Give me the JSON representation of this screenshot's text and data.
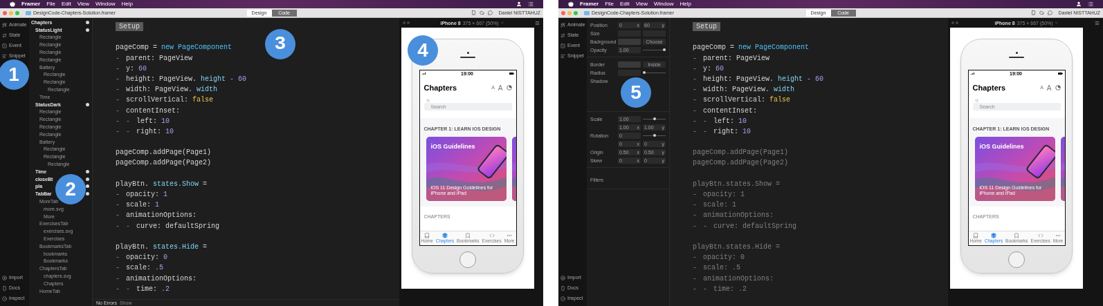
{
  "windows": [
    {
      "menu_bar": {
        "app": "Framer",
        "items": [
          "File",
          "Edit",
          "View",
          "Window",
          "Help"
        ]
      },
      "title_bar": {
        "title": "DesignCode-Chapters-Solution.framer",
        "modes": [
          {
            "label": "Design",
            "selected": false
          },
          {
            "label": "Code",
            "selected": true
          }
        ],
        "user": "Daniel NISTTAHUZ"
      },
      "tool_sidebar": {
        "badge": "1",
        "top": [
          {
            "kind": "animate",
            "label": "Animate"
          },
          {
            "kind": "state",
            "label": "State"
          },
          {
            "kind": "event",
            "label": "Event"
          },
          {
            "kind": "snippet",
            "label": "Snippet"
          }
        ],
        "bottom": [
          {
            "kind": "import",
            "label": "Import"
          },
          {
            "kind": "docs",
            "label": "Docs"
          },
          {
            "kind": "inspect",
            "label": "Inspect"
          }
        ]
      },
      "panel": {
        "kind": "layers",
        "badge": "2",
        "layers": [
          {
            "name": "Chapters",
            "children": [
              {
                "name": "StatusLight",
                "children": [
                  {
                    "name": "Rectangle"
                  },
                  {
                    "name": "Rectangle"
                  },
                  {
                    "name": "Rectangle"
                  },
                  {
                    "name": "Rectangle"
                  },
                  {
                    "name": "Battery",
                    "children": [
                      {
                        "name": "Rectangle"
                      },
                      {
                        "name": "Rectangle",
                        "children": [
                          {
                            "name": "Rectangle"
                          }
                        ]
                      }
                    ]
                  },
                  {
                    "name": "Time"
                  }
                ]
              },
              {
                "name": "StatusDark",
                "children": [
                  {
                    "name": "Rectangle"
                  },
                  {
                    "name": "Rectangle"
                  },
                  {
                    "name": "Rectangle"
                  },
                  {
                    "name": "Rectangle"
                  },
                  {
                    "name": "Battery",
                    "children": [
                      {
                        "name": "Rectangle"
                      },
                      {
                        "name": "Rectangle",
                        "children": [
                          {
                            "name": "Rectangle"
                          }
                        ]
                      }
                    ]
                  }
                ]
              },
              {
                "name": "Time"
              },
              {
                "name": "closeBt"
              },
              {
                "name": "pla"
              },
              {
                "name": "TabBar",
                "children": [
                  {
                    "name": "MoreTab",
                    "children": [
                      {
                        "name": "more.svg"
                      },
                      {
                        "name": "More"
                      }
                    ]
                  },
                  {
                    "name": "ExercisesTab",
                    "children": [
                      {
                        "name": "exercises.svg"
                      },
                      {
                        "name": "Exercises"
                      }
                    ]
                  },
                  {
                    "name": "BookmarksTab",
                    "children": [
                      {
                        "name": "bookmarks"
                      },
                      {
                        "name": "Bookmarks"
                      }
                    ]
                  },
                  {
                    "name": "ChaptersTab",
                    "children": [
                      {
                        "name": "chapters.svg"
                      },
                      {
                        "name": "Chapters"
                      }
                    ]
                  },
                  {
                    "name": "HomeTab"
                  }
                ]
              }
            ]
          }
        ]
      },
      "editor": {
        "badge": "3",
        "heading": "Setup",
        "status": {
          "text": "No Errors",
          "action": "Show"
        },
        "lines": [
          {
            "kind": "blank"
          },
          {
            "kind": "code",
            "dimmed": false,
            "tokens": [
              {
                "kind": "text",
                "text": "pageComp ="
              },
              {
                "kind": "keyword",
                "text": "new"
              },
              {
                "kind": "type",
                "text": "PageComponent"
              }
            ]
          },
          {
            "kind": "code",
            "dimmed": false,
            "tokens": [
              {
                "kind": "guide",
                "text": "-"
              },
              {
                "kind": "text",
                "text": "parent: PageView"
              }
            ]
          },
          {
            "kind": "code",
            "dimmed": false,
            "tokens": [
              {
                "kind": "guide",
                "text": "-"
              },
              {
                "kind": "text",
                "text": "y:"
              },
              {
                "kind": "num",
                "text": "60"
              }
            ]
          },
          {
            "kind": "code",
            "dimmed": false,
            "tokens": [
              {
                "kind": "guide",
                "text": "-"
              },
              {
                "kind": "text",
                "text": "height: PageView."
              },
              {
                "kind": "prop",
                "text": "height"
              },
              {
                "kind": "num",
                "text": "- 60"
              }
            ]
          },
          {
            "kind": "code",
            "dimmed": false,
            "tokens": [
              {
                "kind": "guide",
                "text": "-"
              },
              {
                "kind": "text",
                "text": "width: PageView."
              },
              {
                "kind": "prop",
                "text": "width"
              }
            ]
          },
          {
            "kind": "code",
            "dimmed": false,
            "tokens": [
              {
                "kind": "guide",
                "text": "-"
              },
              {
                "kind": "text",
                "text": "scrollVertical:"
              },
              {
                "kind": "bool",
                "text": "false"
              }
            ]
          },
          {
            "kind": "code",
            "dimmed": false,
            "tokens": [
              {
                "kind": "guide",
                "text": "-"
              },
              {
                "kind": "text",
                "text": "contentInset:"
              }
            ]
          },
          {
            "kind": "code",
            "dimmed": false,
            "tokens": [
              {
                "kind": "guide",
                "text": "-"
              },
              {
                "kind": "guide",
                "text": "-"
              },
              {
                "kind": "text",
                "text": "left:"
              },
              {
                "kind": "num",
                "text": "10"
              }
            ]
          },
          {
            "kind": "code",
            "dimmed": false,
            "tokens": [
              {
                "kind": "guide",
                "text": "-"
              },
              {
                "kind": "guide",
                "text": "-"
              },
              {
                "kind": "text",
                "text": "right:"
              },
              {
                "kind": "num",
                "text": "10"
              }
            ]
          },
          {
            "kind": "blank"
          },
          {
            "kind": "code",
            "dimmed": false,
            "tokens": [
              {
                "kind": "text",
                "text": "pageComp.addPage(Page1)"
              }
            ]
          },
          {
            "kind": "code",
            "dimmed": false,
            "tokens": [
              {
                "kind": "text",
                "text": "pageComp.addPage(Page2)"
              }
            ]
          },
          {
            "kind": "blank"
          },
          {
            "kind": "code",
            "dimmed": false,
            "tokens": [
              {
                "kind": "text",
                "text": "playBtn."
              },
              {
                "kind": "prop",
                "text": "states.Show"
              },
              {
                "kind": "text",
                "text": "="
              }
            ]
          },
          {
            "kind": "code",
            "dimmed": false,
            "tokens": [
              {
                "kind": "guide",
                "text": "-"
              },
              {
                "kind": "text",
                "text": "opacity:"
              },
              {
                "kind": "num",
                "text": "1"
              }
            ]
          },
          {
            "kind": "code",
            "dimmed": false,
            "tokens": [
              {
                "kind": "guide",
                "text": "-"
              },
              {
                "kind": "text",
                "text": "scale:"
              },
              {
                "kind": "num",
                "text": "1"
              }
            ]
          },
          {
            "kind": "code",
            "dimmed": false,
            "tokens": [
              {
                "kind": "guide",
                "text": "-"
              },
              {
                "kind": "text",
                "text": "animationOptions:"
              }
            ]
          },
          {
            "kind": "code",
            "dimmed": false,
            "tokens": [
              {
                "kind": "guide",
                "text": "-"
              },
              {
                "kind": "guide",
                "text": "-"
              },
              {
                "kind": "text",
                "text": "curve: defaultSpring"
              }
            ]
          },
          {
            "kind": "blank"
          },
          {
            "kind": "code",
            "dimmed": false,
            "tokens": [
              {
                "kind": "text",
                "text": "playBtn."
              },
              {
                "kind": "prop",
                "text": "states.Hide"
              },
              {
                "kind": "text",
                "text": "="
              }
            ]
          },
          {
            "kind": "code",
            "dimmed": false,
            "tokens": [
              {
                "kind": "guide",
                "text": "-"
              },
              {
                "kind": "text",
                "text": "opacity:"
              },
              {
                "kind": "num",
                "text": "0"
              }
            ]
          },
          {
            "kind": "code",
            "dimmed": false,
            "tokens": [
              {
                "kind": "guide",
                "text": "-"
              },
              {
                "kind": "text",
                "text": "scale:"
              },
              {
                "kind": "num",
                "text": ".5"
              }
            ]
          },
          {
            "kind": "code",
            "dimmed": false,
            "tokens": [
              {
                "kind": "guide",
                "text": "-"
              },
              {
                "kind": "text",
                "text": "animationOptions:"
              }
            ]
          },
          {
            "kind": "code",
            "dimmed": false,
            "tokens": [
              {
                "kind": "guide",
                "text": "-"
              },
              {
                "kind": "guide",
                "text": "-"
              },
              {
                "kind": "text",
                "text": "time:"
              },
              {
                "kind": "num",
                "text": ".2"
              }
            ]
          }
        ]
      },
      "preview": {
        "badge": "4",
        "device": "iPhone 8",
        "size": "375 × 667 (50%)",
        "screen": {
          "time": "19:00",
          "title": "Chapters",
          "text_sizes": [
            "A",
            "A"
          ],
          "search": {
            "placeholder": "Search"
          },
          "section": "CHAPTER 1: LEARN IOS DESIGN",
          "cards": [
            {
              "kind": "course",
              "title": "iOS Guidelines",
              "subtitle": "iOS 11 Design Guidelines for iPhone and iPad"
            },
            {
              "kind": "picture"
            }
          ],
          "list_heading": "CHAPTERS",
          "tabs": [
            {
              "kind": "home",
              "label": "Home",
              "selected": false
            },
            {
              "kind": "chapters",
              "label": "Chapters",
              "selected": true
            },
            {
              "kind": "bookmarks",
              "label": "Bookmarks",
              "selected": false
            },
            {
              "kind": "exercises",
              "label": "Exercises",
              "selected": false
            },
            {
              "kind": "more",
              "label": "More",
              "selected": false
            }
          ]
        }
      }
    },
    {
      "menu_bar": {
        "app": "Framer",
        "items": [
          "File",
          "Edit",
          "View",
          "Window",
          "Help"
        ]
      },
      "title_bar": {
        "title": "DesignCode-Chapters-Solution.framer",
        "modes": [
          {
            "label": "Design",
            "selected": false
          },
          {
            "label": "Code",
            "selected": true
          }
        ],
        "user": "Daniel NISTTAHUZ"
      },
      "tool_sidebar": {
        "top": [
          {
            "kind": "animate",
            "label": "Animate"
          },
          {
            "kind": "state",
            "label": "State"
          },
          {
            "kind": "event",
            "label": "Event"
          },
          {
            "kind": "snippet",
            "label": "Snippet"
          }
        ],
        "bottom": [
          {
            "kind": "import",
            "label": "Import"
          },
          {
            "kind": "docs",
            "label": "Docs"
          },
          {
            "kind": "inspect",
            "label": "Inspect"
          }
        ]
      },
      "panel": {
        "kind": "properties",
        "badge": "5",
        "section": "Filters",
        "groups": [
          {
            "rows": [
              {
                "kind": "pair",
                "label": "Position",
                "fields": [
                  {
                    "value": "0",
                    "unit": "x"
                  },
                  {
                    "value": "60",
                    "unit": "y"
                  }
                ]
              },
              {
                "kind": "blank_pair",
                "label": "Size"
              },
              {
                "kind": "color",
                "label": "Background",
                "button": "Choose"
              },
              {
                "kind": "slider",
                "label": "Opacity",
                "value": "1.00",
                "level": 1
              }
            ]
          },
          {
            "rows": [
              {
                "kind": "color",
                "label": "Border",
                "button": "Inside"
              },
              {
                "kind": "slider",
                "label": "Radius",
                "level": 0
              },
              {
                "kind": "covered",
                "label": "Shadow"
              }
            ]
          },
          {
            "rows": [
              {
                "kind": "slider",
                "label": "Scale",
                "value": "1.00",
                "level": 0.5
              },
              {
                "kind": "pair",
                "fields": [
                  {
                    "value": "1.00",
                    "unit": "x"
                  },
                  {
                    "value": "1.00",
                    "unit": "y"
                  }
                ]
              },
              {
                "kind": "slider",
                "label": "Rotation",
                "value": "0",
                "level": 0.5
              },
              {
                "kind": "pair",
                "fields": [
                  {
                    "value": "0",
                    "unit": "x"
                  },
                  {
                    "value": "0",
                    "unit": "y"
                  }
                ]
              },
              {
                "kind": "pair",
                "label": "Origin",
                "fields": [
                  {
                    "value": "0.50",
                    "unit": "x"
                  },
                  {
                    "value": "0.50",
                    "unit": "y"
                  }
                ]
              },
              {
                "kind": "pair",
                "label": "Skew",
                "fields": [
                  {
                    "value": "0",
                    "unit": "x"
                  },
                  {
                    "value": "0",
                    "unit": "y"
                  }
                ]
              }
            ]
          }
        ]
      },
      "editor": {
        "heading": "Setup",
        "lines": [
          {
            "kind": "blank"
          },
          {
            "kind": "code",
            "dimmed": false,
            "tokens": [
              {
                "kind": "text",
                "text": "pageComp ="
              },
              {
                "kind": "keyword",
                "text": "new"
              },
              {
                "kind": "type",
                "text": "PageComponent"
              }
            ]
          },
          {
            "kind": "code",
            "dimmed": false,
            "tokens": [
              {
                "kind": "guide",
                "text": "-"
              },
              {
                "kind": "text",
                "text": "parent: PageView"
              }
            ]
          },
          {
            "kind": "code",
            "dimmed": false,
            "tokens": [
              {
                "kind": "guide",
                "text": "-"
              },
              {
                "kind": "text",
                "text": "y:"
              },
              {
                "kind": "num",
                "text": "60"
              }
            ]
          },
          {
            "kind": "code",
            "dimmed": false,
            "tokens": [
              {
                "kind": "guide",
                "text": "-"
              },
              {
                "kind": "text",
                "text": "height: PageView."
              },
              {
                "kind": "prop",
                "text": "height"
              },
              {
                "kind": "num",
                "text": "- 60"
              }
            ]
          },
          {
            "kind": "code",
            "dimmed": false,
            "tokens": [
              {
                "kind": "guide",
                "text": "-"
              },
              {
                "kind": "text",
                "text": "width: PageView."
              },
              {
                "kind": "prop",
                "text": "width"
              }
            ]
          },
          {
            "kind": "code",
            "dimmed": false,
            "tokens": [
              {
                "kind": "guide",
                "text": "-"
              },
              {
                "kind": "text",
                "text": "scrollVertical:"
              },
              {
                "kind": "bool",
                "text": "false"
              }
            ]
          },
          {
            "kind": "code",
            "dimmed": false,
            "tokens": [
              {
                "kind": "guide",
                "text": "-"
              },
              {
                "kind": "text",
                "text": "contentInset:"
              }
            ]
          },
          {
            "kind": "code",
            "dimmed": false,
            "tokens": [
              {
                "kind": "guide",
                "text": "-"
              },
              {
                "kind": "guide",
                "text": "-"
              },
              {
                "kind": "text",
                "text": "left:"
              },
              {
                "kind": "num",
                "text": "10"
              }
            ]
          },
          {
            "kind": "code",
            "dimmed": false,
            "tokens": [
              {
                "kind": "guide",
                "text": "-"
              },
              {
                "kind": "guide",
                "text": "-"
              },
              {
                "kind": "text",
                "text": "right:"
              },
              {
                "kind": "num",
                "text": "10"
              }
            ]
          },
          {
            "kind": "blank"
          },
          {
            "kind": "code",
            "dimmed": true,
            "tokens": [
              {
                "kind": "text",
                "text": "pageComp.addPage(Page1)"
              }
            ]
          },
          {
            "kind": "code",
            "dimmed": true,
            "tokens": [
              {
                "kind": "text",
                "text": "pageComp.addPage(Page2)"
              }
            ]
          },
          {
            "kind": "blank"
          },
          {
            "kind": "code",
            "dimmed": true,
            "tokens": [
              {
                "kind": "text",
                "text": "playBtn.states.Show ="
              }
            ]
          },
          {
            "kind": "code",
            "dimmed": true,
            "tokens": [
              {
                "kind": "guide",
                "text": "-"
              },
              {
                "kind": "text",
                "text": "opacity: 1"
              }
            ]
          },
          {
            "kind": "code",
            "dimmed": true,
            "tokens": [
              {
                "kind": "guide",
                "text": "-"
              },
              {
                "kind": "text",
                "text": "scale: 1"
              }
            ]
          },
          {
            "kind": "code",
            "dimmed": true,
            "tokens": [
              {
                "kind": "guide",
                "text": "-"
              },
              {
                "kind": "text",
                "text": "animationOptions:"
              }
            ]
          },
          {
            "kind": "code",
            "dimmed": true,
            "tokens": [
              {
                "kind": "guide",
                "text": "-"
              },
              {
                "kind": "guide",
                "text": "-"
              },
              {
                "kind": "text",
                "text": "curve: defaultSpring"
              }
            ]
          },
          {
            "kind": "blank"
          },
          {
            "kind": "code",
            "dimmed": true,
            "tokens": [
              {
                "kind": "text",
                "text": "playBtn.states.Hide ="
              }
            ]
          },
          {
            "kind": "code",
            "dimmed": true,
            "tokens": [
              {
                "kind": "guide",
                "text": "-"
              },
              {
                "kind": "text",
                "text": "opacity: 0"
              }
            ]
          },
          {
            "kind": "code",
            "dimmed": true,
            "tokens": [
              {
                "kind": "guide",
                "text": "-"
              },
              {
                "kind": "text",
                "text": "scale: .5"
              }
            ]
          },
          {
            "kind": "code",
            "dimmed": true,
            "tokens": [
              {
                "kind": "guide",
                "text": "-"
              },
              {
                "kind": "text",
                "text": "animationOptions:"
              }
            ]
          },
          {
            "kind": "code",
            "dimmed": true,
            "tokens": [
              {
                "kind": "guide",
                "text": "-"
              },
              {
                "kind": "guide",
                "text": "-"
              },
              {
                "kind": "text",
                "text": "time: .2"
              }
            ]
          }
        ]
      },
      "preview": {
        "device": "iPhone 8",
        "size": "375 × 667 (50%)",
        "screen": {
          "time": "19:00",
          "title": "Chapters",
          "text_sizes": [
            "A",
            "A"
          ],
          "search": {
            "placeholder": "Search"
          },
          "section": "CHAPTER 1: LEARN IOS DESIGN",
          "cards": [
            {
              "kind": "course",
              "title": "iOS Guidelines",
              "subtitle": "iOS 11 Design Guidelines for iPhone and iPad"
            },
            {
              "kind": "picture"
            }
          ],
          "list_heading": "CHAPTERS",
          "tabs": [
            {
              "kind": "home",
              "label": "Home",
              "selected": false
            },
            {
              "kind": "chapters",
              "label": "Chapters",
              "selected": true
            },
            {
              "kind": "bookmarks",
              "label": "Bookmarks",
              "selected": false
            },
            {
              "kind": "exercises",
              "label": "Exercises",
              "selected": false
            },
            {
              "kind": "more",
              "label": "More",
              "selected": false
            }
          ]
        }
      }
    }
  ]
}
